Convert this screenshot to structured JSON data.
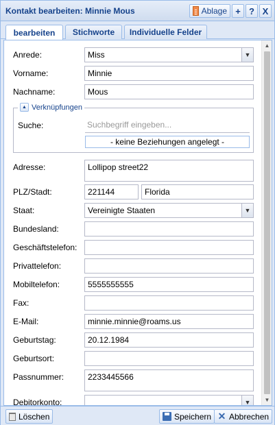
{
  "window": {
    "title": "Kontakt bearbeiten: Minnie Mous"
  },
  "toolbar": {
    "ablage_label": "Ablage",
    "add_label": "+",
    "help_label": "?",
    "close_label": "X"
  },
  "tabs": [
    {
      "label": "bearbeiten",
      "active": true
    },
    {
      "label": "Stichworte",
      "active": false
    },
    {
      "label": "Individuelle Felder",
      "active": false
    }
  ],
  "form": {
    "anrede": {
      "label": "Anrede:",
      "value": "Miss"
    },
    "vorname": {
      "label": "Vorname:",
      "value": "Minnie"
    },
    "nachname": {
      "label": "Nachname:",
      "value": "Mous"
    },
    "verknuepfungen": {
      "legend": "Verknüpfungen",
      "search_label": "Suche:",
      "search_placeholder": "Suchbegriff eingeben...",
      "relations_text": "-  keine Beziehungen angelegt  -"
    },
    "adresse": {
      "label": "Adresse:",
      "value": "Lollipop  street22"
    },
    "plz_stadt": {
      "label": "PLZ/Stadt:",
      "plz": "221144",
      "stadt": "Florida"
    },
    "staat": {
      "label": "Staat:",
      "value": "Vereinigte Staaten"
    },
    "bundesland": {
      "label": "Bundesland:",
      "value": ""
    },
    "geschaeftstelefon": {
      "label": "Geschäftstelefon:",
      "value": ""
    },
    "privattelefon": {
      "label": "Privattelefon:",
      "value": ""
    },
    "mobiltelefon": {
      "label": "Mobiltelefon:",
      "value": "5555555555"
    },
    "fax": {
      "label": "Fax:",
      "value": ""
    },
    "email": {
      "label": "E-Mail:",
      "value": "minnie.minnie@roams.us"
    },
    "geburtstag": {
      "label": "Geburtstag:",
      "value": "20.12.1984"
    },
    "geburtsort": {
      "label": "Geburtsort:",
      "value": ""
    },
    "passnummer": {
      "label": "Passnummer:",
      "value": "2233445566"
    },
    "debitorkonto": {
      "label": "Debitorkonto:",
      "value": ""
    }
  },
  "footer": {
    "delete_label": "Löschen",
    "save_label": "Speichern",
    "cancel_label": "Abbrechen"
  },
  "icons": {
    "ablage": "document-icon",
    "add": "plus-icon",
    "help": "help-icon",
    "close": "close-icon",
    "collapse": "collapse-up-icon",
    "combo": "chevron-down-icon",
    "delete": "trash-icon",
    "save": "floppy-icon",
    "cancel": "cross-icon"
  },
  "colors": {
    "header_text": "#15428b",
    "border": "#99bbe8",
    "panel_bg": "#dfe8f6"
  }
}
